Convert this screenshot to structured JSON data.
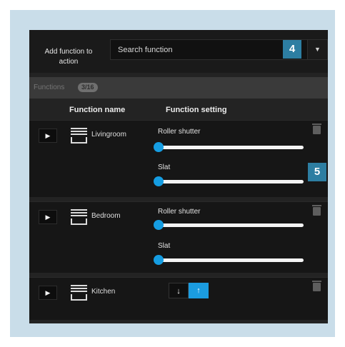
{
  "header": {
    "add_function_label": "Add function to action",
    "search_placeholder": "Search function",
    "dropdown_icon": "chevron-down-icon"
  },
  "callouts": [
    "4",
    "5"
  ],
  "functions_bar": {
    "label": "Functions",
    "count": "3/16"
  },
  "columns": {
    "name": "Function name",
    "setting": "Function setting"
  },
  "rows": [
    {
      "name": "Livingroom",
      "slider1_label": "Roller shutter",
      "slider1_value": 0,
      "slider2_label": "Slat",
      "slider2_value": 0
    },
    {
      "name": "Bedroom",
      "slider1_label": "Roller shutter",
      "slider1_value": 0,
      "slider2_label": "Slat",
      "slider2_value": 0
    },
    {
      "name": "Kitchen",
      "down_label": "↓",
      "up_label": "↑"
    }
  ],
  "colors": {
    "accent": "#1b9ce0",
    "callout": "#2d7ea2",
    "panel": "#232323",
    "frame": "#c9dde9"
  }
}
